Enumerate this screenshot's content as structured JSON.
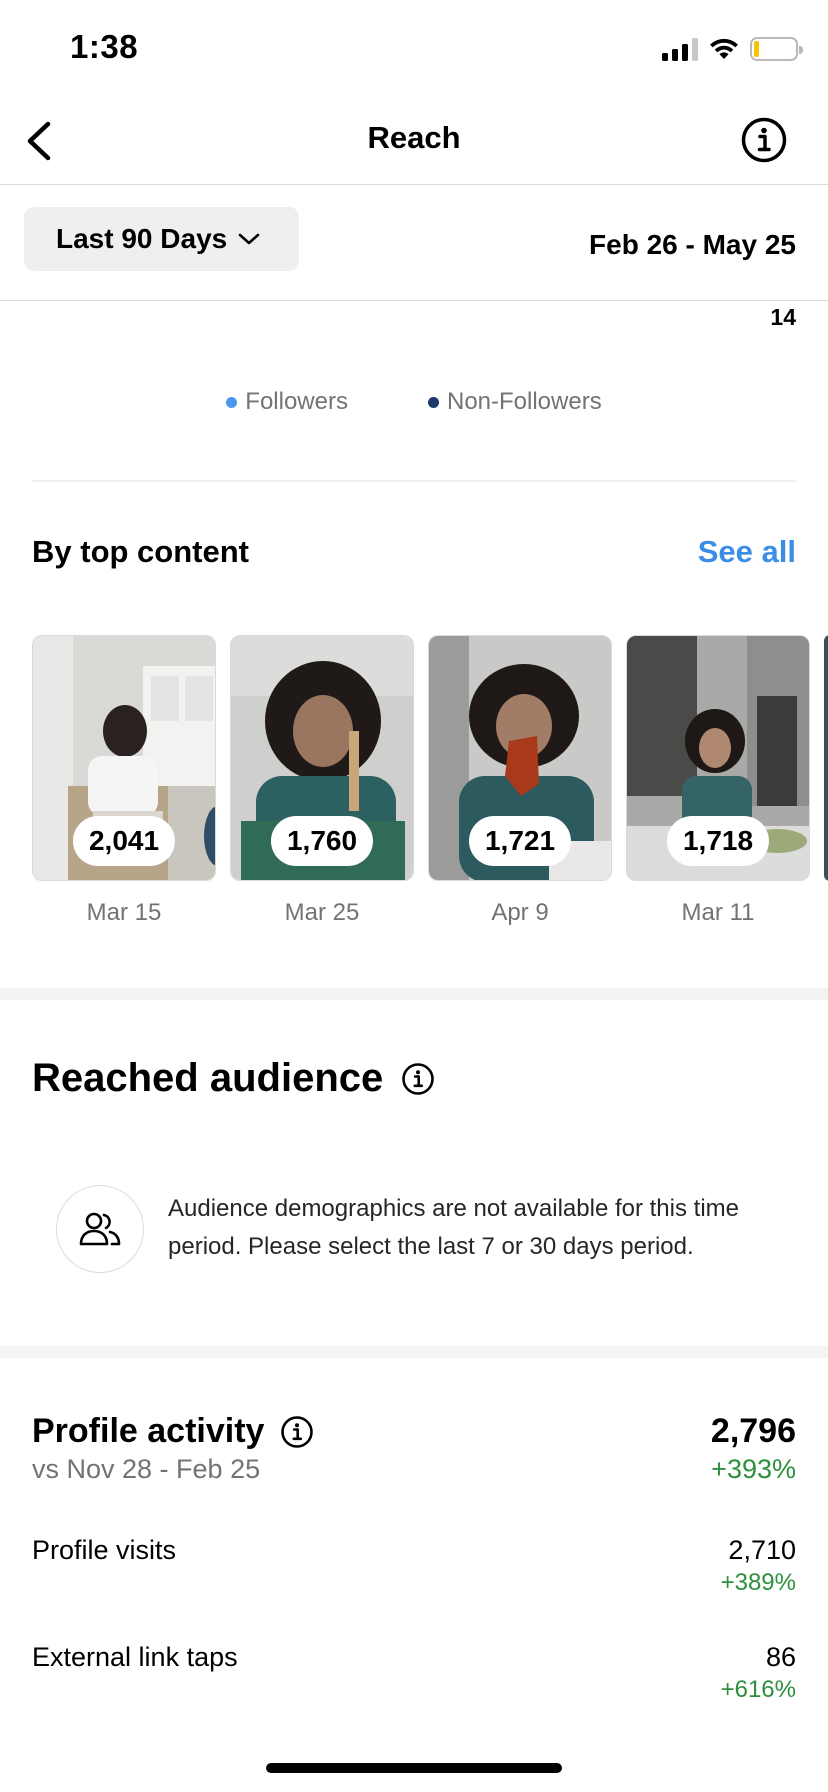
{
  "status_bar": {
    "time": "1:38"
  },
  "nav": {
    "title": "Reach"
  },
  "filter": {
    "period_label": "Last 90 Days",
    "date_range": "Feb 26 - May 25"
  },
  "chart_tail": {
    "tick_label": "14"
  },
  "legend": [
    {
      "label": "Followers",
      "color": "#4a97ec"
    },
    {
      "label": "Non-Followers",
      "color": "#1d3a66"
    }
  ],
  "top_content": {
    "heading": "By top content",
    "see_all": "See all",
    "items": [
      {
        "value": "2,041",
        "date": "Mar 15"
      },
      {
        "value": "1,760",
        "date": "Mar 25"
      },
      {
        "value": "1,721",
        "date": "Apr 9"
      },
      {
        "value": "1,718",
        "date": "Mar 11"
      }
    ]
  },
  "reached_audience": {
    "title": "Reached audience",
    "message": "Audience demographics are not available for this time period. Please select the last 7 or 30 days period."
  },
  "profile_activity": {
    "title": "Profile activity",
    "comparison": "vs Nov 28 - Feb 25",
    "total": "2,796",
    "change": "+393%",
    "metrics": [
      {
        "label": "Profile visits",
        "value": "2,710",
        "change": "+389%"
      },
      {
        "label": "External link taps",
        "value": "86",
        "change": "+616%"
      }
    ]
  },
  "colors": {
    "accent_link": "#3b8de6",
    "positive": "#2e8f3e"
  }
}
